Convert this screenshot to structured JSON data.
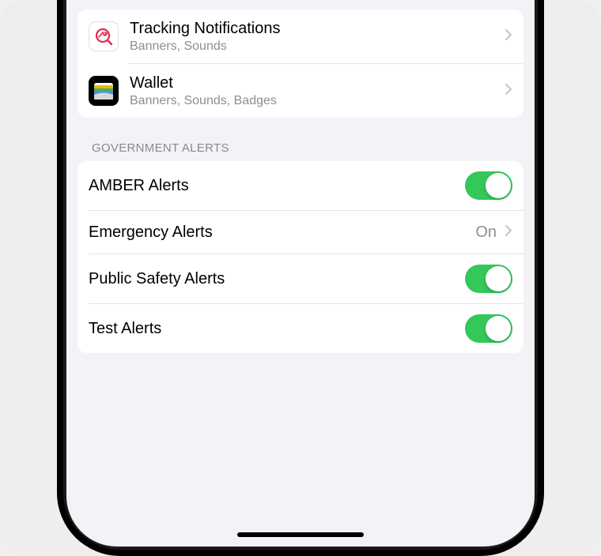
{
  "apps": {
    "tracking": {
      "title": "Tracking Notifications",
      "subtitle": "Banners, Sounds"
    },
    "wallet": {
      "title": "Wallet",
      "subtitle": "Banners, Sounds, Badges"
    }
  },
  "section": {
    "header": "GOVERNMENT ALERTS",
    "amber": {
      "label": "AMBER Alerts",
      "on": true
    },
    "emergency": {
      "label": "Emergency Alerts",
      "value": "On"
    },
    "public_safety": {
      "label": "Public Safety Alerts",
      "on": true
    },
    "test": {
      "label": "Test Alerts",
      "on": true
    }
  }
}
